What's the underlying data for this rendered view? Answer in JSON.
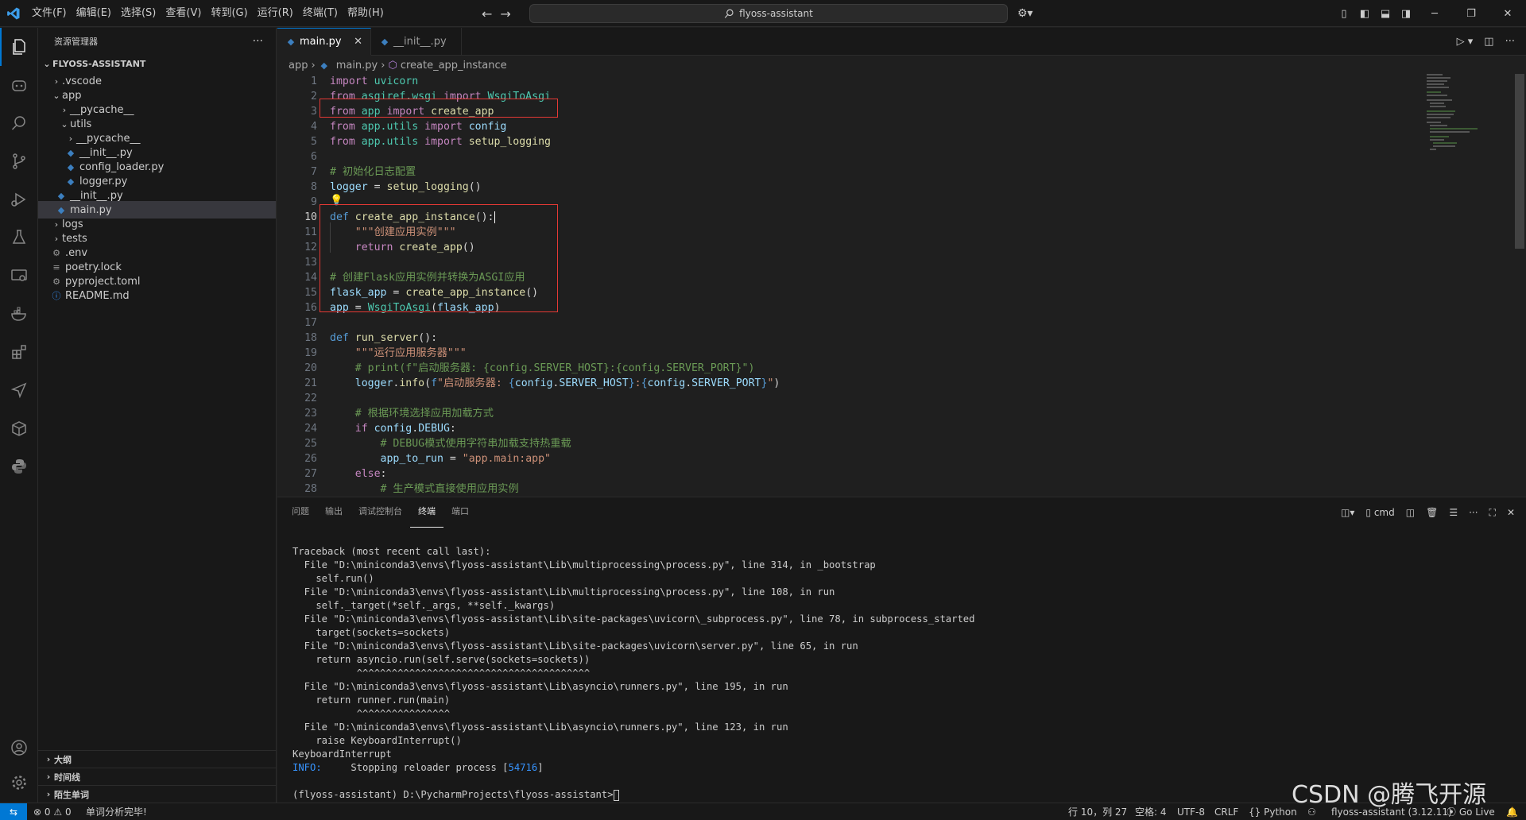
{
  "menu": [
    "文件(F)",
    "编辑(E)",
    "选择(S)",
    "查看(V)",
    "转到(G)",
    "运行(R)",
    "终端(T)",
    "帮助(H)"
  ],
  "search": {
    "text": "flyoss-assistant"
  },
  "explorer": {
    "title": "资源管理器",
    "root": "FLYOSS-ASSISTANT",
    "items": [
      {
        "label": ".vscode",
        "kind": "folder"
      },
      {
        "label": "app",
        "kind": "folder-open"
      },
      {
        "label": "__pycache__",
        "kind": "folder"
      },
      {
        "label": "utils",
        "kind": "folder-open"
      },
      {
        "label": "__pycache__",
        "kind": "folder"
      },
      {
        "label": "__init__.py",
        "kind": "py"
      },
      {
        "label": "config_loader.py",
        "kind": "py"
      },
      {
        "label": "logger.py",
        "kind": "py"
      },
      {
        "label": "__init__.py",
        "kind": "py"
      },
      {
        "label": "main.py",
        "kind": "py"
      },
      {
        "label": "logs",
        "kind": "folder"
      },
      {
        "label": "tests",
        "kind": "folder"
      },
      {
        "label": ".env",
        "kind": "gear"
      },
      {
        "label": "poetry.lock",
        "kind": "lines"
      },
      {
        "label": "pyproject.toml",
        "kind": "gear"
      },
      {
        "label": "README.md",
        "kind": "info"
      }
    ],
    "sections": [
      "大纲",
      "时间线",
      "陌生单词"
    ]
  },
  "tabs": [
    {
      "label": "main.py"
    },
    {
      "label": "__init__.py"
    }
  ],
  "breadcrumb": {
    "folder": "app",
    "file": "main.py",
    "symbol": "create_app_instance"
  },
  "code_lines": [
    "1",
    "2",
    "3",
    "4",
    "5",
    "6",
    "7",
    "8",
    "9",
    "10",
    "11",
    "12",
    "13",
    "14",
    "15",
    "16",
    "17",
    "18",
    "19",
    "20",
    "21",
    "22",
    "23",
    "24",
    "25",
    "26",
    "27",
    "28"
  ],
  "panel": {
    "tabs": [
      "问题",
      "输出",
      "调试控制台",
      "终端",
      "端口"
    ],
    "shell": "cmd",
    "terminal": [
      "Traceback (most recent call last):",
      "  File \"D:\\miniconda3\\envs\\flyoss-assistant\\Lib\\multiprocessing\\process.py\", line 314, in _bootstrap",
      "    self.run()",
      "  File \"D:\\miniconda3\\envs\\flyoss-assistant\\Lib\\multiprocessing\\process.py\", line 108, in run",
      "    self._target(*self._args, **self._kwargs)",
      "  File \"D:\\miniconda3\\envs\\flyoss-assistant\\Lib\\site-packages\\uvicorn\\_subprocess.py\", line 78, in subprocess_started",
      "    target(sockets=sockets)",
      "  File \"D:\\miniconda3\\envs\\flyoss-assistant\\Lib\\site-packages\\uvicorn\\server.py\", line 65, in run",
      "    return asyncio.run(self.serve(sockets=sockets))",
      "           ^^^^^^^^^^^^^^^^^^^^^^^^^^^^^^^^^^^^^^^^",
      "  File \"D:\\miniconda3\\envs\\flyoss-assistant\\Lib\\asyncio\\runners.py\", line 195, in run",
      "    return runner.run(main)",
      "           ^^^^^^^^^^^^^^^^",
      "  File \"D:\\miniconda3\\envs\\flyoss-assistant\\Lib\\asyncio\\runners.py\", line 123, in run",
      "    raise KeyboardInterrupt()",
      "KeyboardInterrupt"
    ],
    "info_label": "INFO:",
    "info_text": "     Stopping reloader process [",
    "info_pid": "54716",
    "info_end": "]",
    "prompt": "(flyoss-assistant) D:\\PycharmProjects\\flyoss-assistant>"
  },
  "status": {
    "errors": "0",
    "warnings": "0",
    "message": "单词分析完毕!",
    "cursor": "行 10，列 27",
    "spaces": "空格: 4",
    "encoding": "UTF-8",
    "eol": "CRLF",
    "language": "Python",
    "interpreter": "flyoss-assistant (3.12.11)",
    "golive": "Go Live"
  },
  "watermark": "CSDN @腾飞开源"
}
